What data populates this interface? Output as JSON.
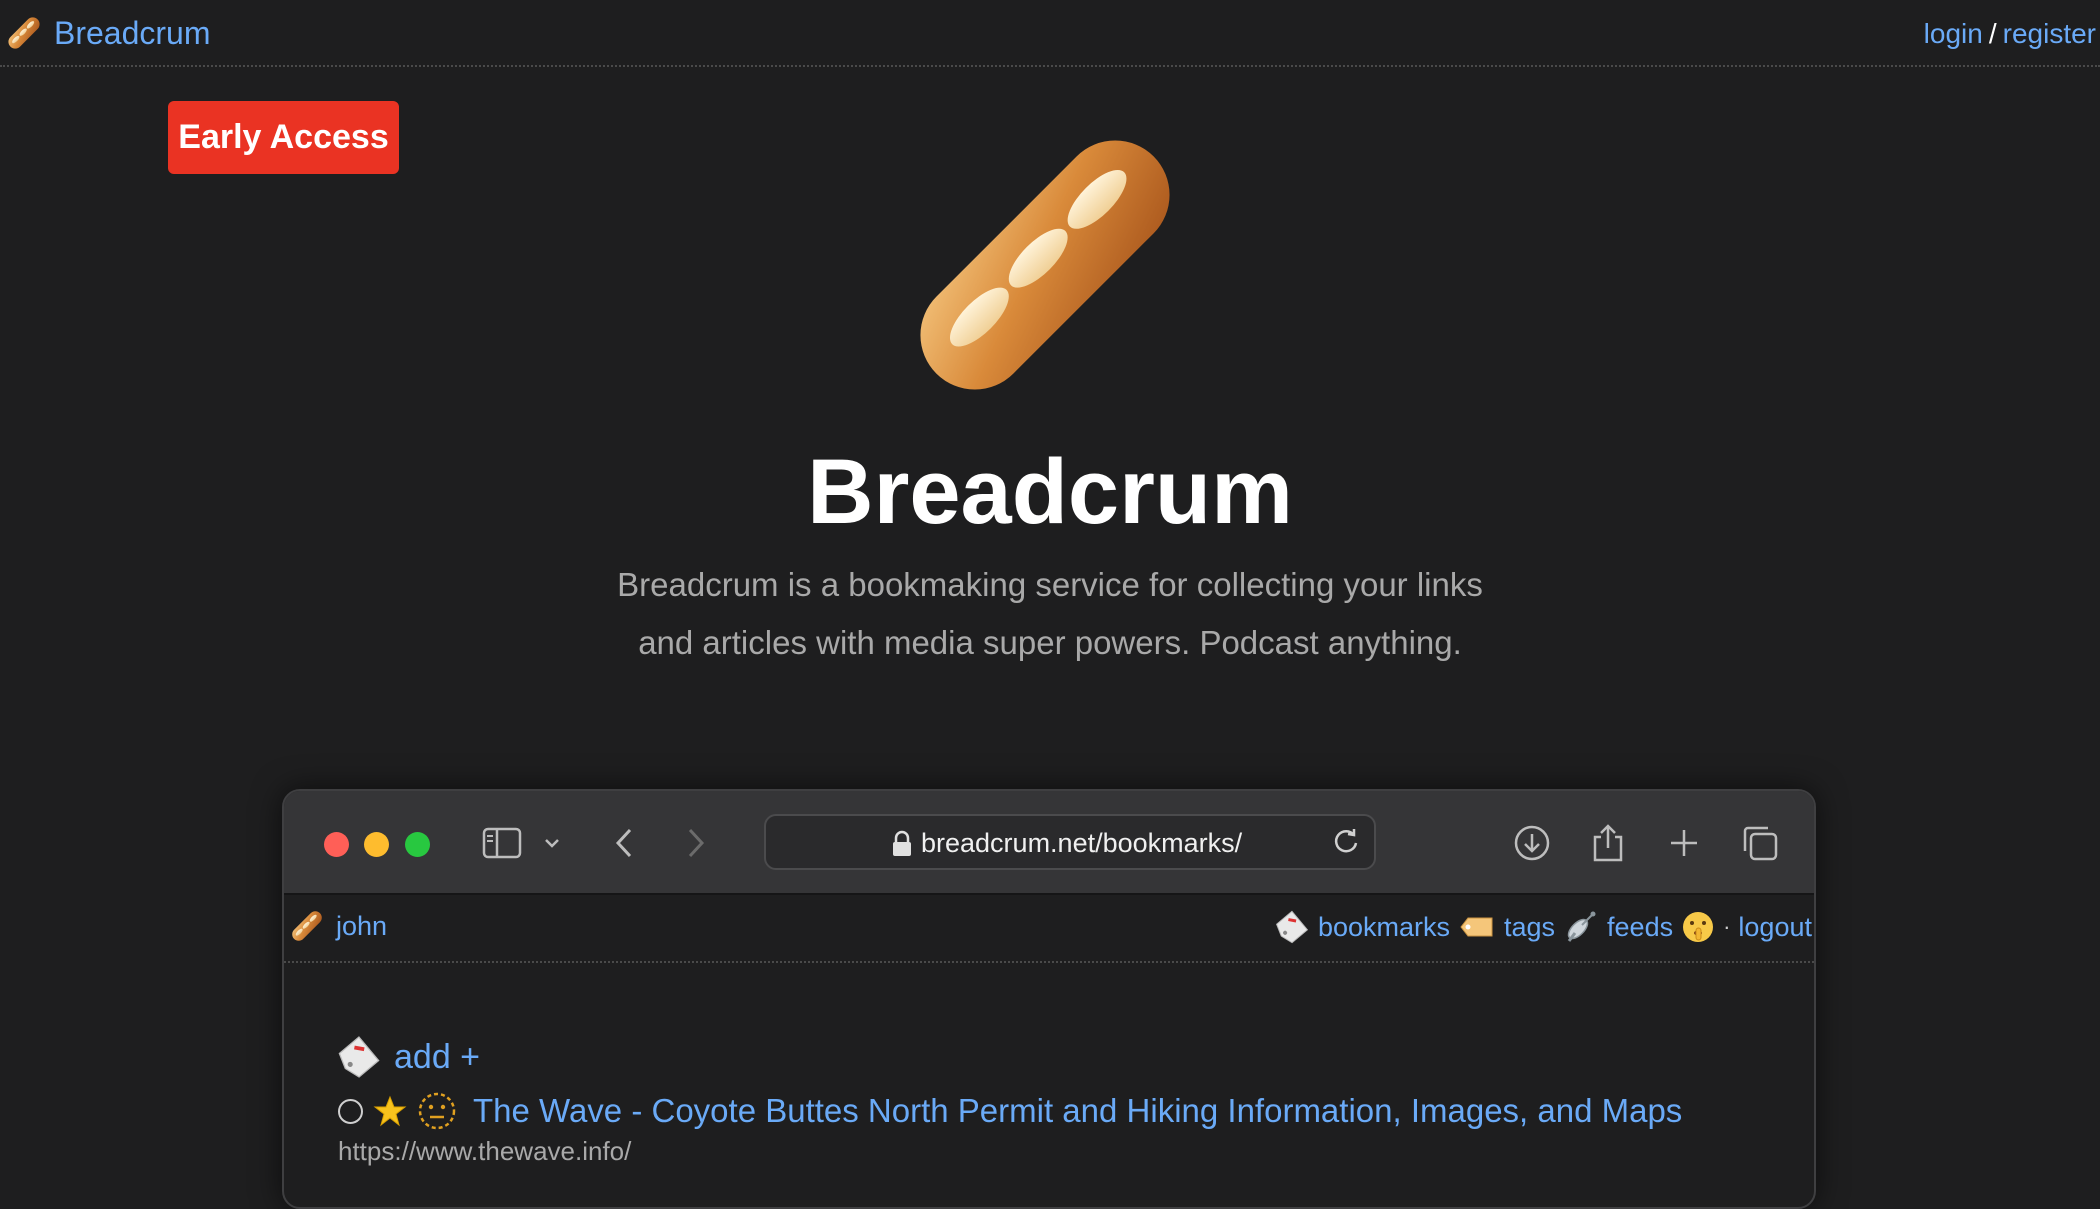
{
  "header": {
    "brand": "Breadcrum",
    "login": "login",
    "separator": "/",
    "register": "register"
  },
  "badge": {
    "label": "Early Access"
  },
  "hero": {
    "title": "Breadcrum",
    "description_line1": "Breadcrum is a bookmaking service for collecting your links",
    "description_line2": "and articles with media super powers. Podcast anything."
  },
  "browser": {
    "url": "breadcrum.net/bookmarks/",
    "user": "john",
    "nav": {
      "bookmarks": "bookmarks",
      "tags": "tags",
      "feeds": "feeds",
      "dot": "·",
      "logout": "logout"
    },
    "add_label": "add +",
    "bookmark": {
      "title": "The Wave - Coyote Buttes North Permit and Hiking Information, Images, and Maps",
      "url": "https://www.thewave.info/"
    }
  },
  "colors": {
    "background": "#1e1e1f",
    "link": "#6aaaf7",
    "badge": "#ea3323",
    "muted": "#a9a9a9"
  },
  "icons": [
    "bread-icon",
    "bookmark-tag-icon",
    "tag-icon",
    "satellite-icon",
    "shushing-face-icon",
    "star-icon",
    "neutral-face-icon"
  ]
}
